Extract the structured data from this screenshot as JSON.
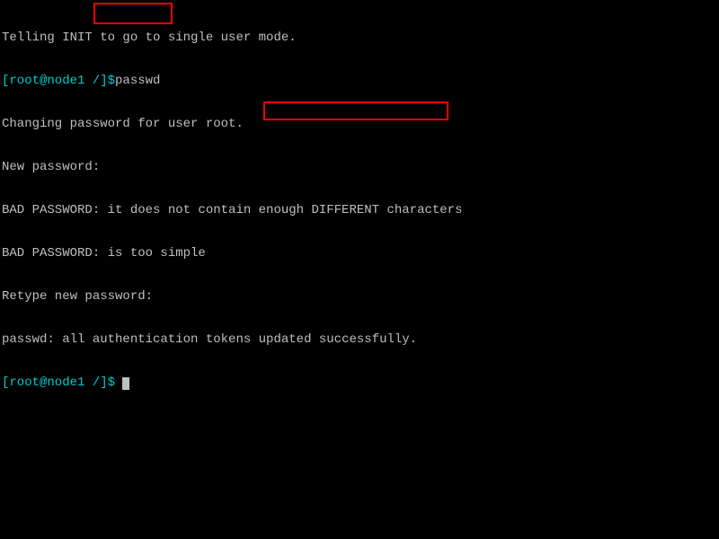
{
  "lines": {
    "l0_a": "Telling INIT ",
    "l0_b": "to go to s",
    "l0_c": "ingle user mode.",
    "l1_prompt": "[root@node1 /]$",
    "l1_cmd": "passwd",
    "l2": "Changing password for user root.",
    "l3": "New password:",
    "l4": "BAD PASSWORD: it does not contain enough DIFFERENT characters",
    "l5": "BAD PASSWORD: is too simple",
    "l6": "Retype new password:",
    "l7_a": "passwd: all authentication tokens ",
    "l7_b": "updated successfully.",
    "l8_prompt": "[root@node1 /]$"
  }
}
